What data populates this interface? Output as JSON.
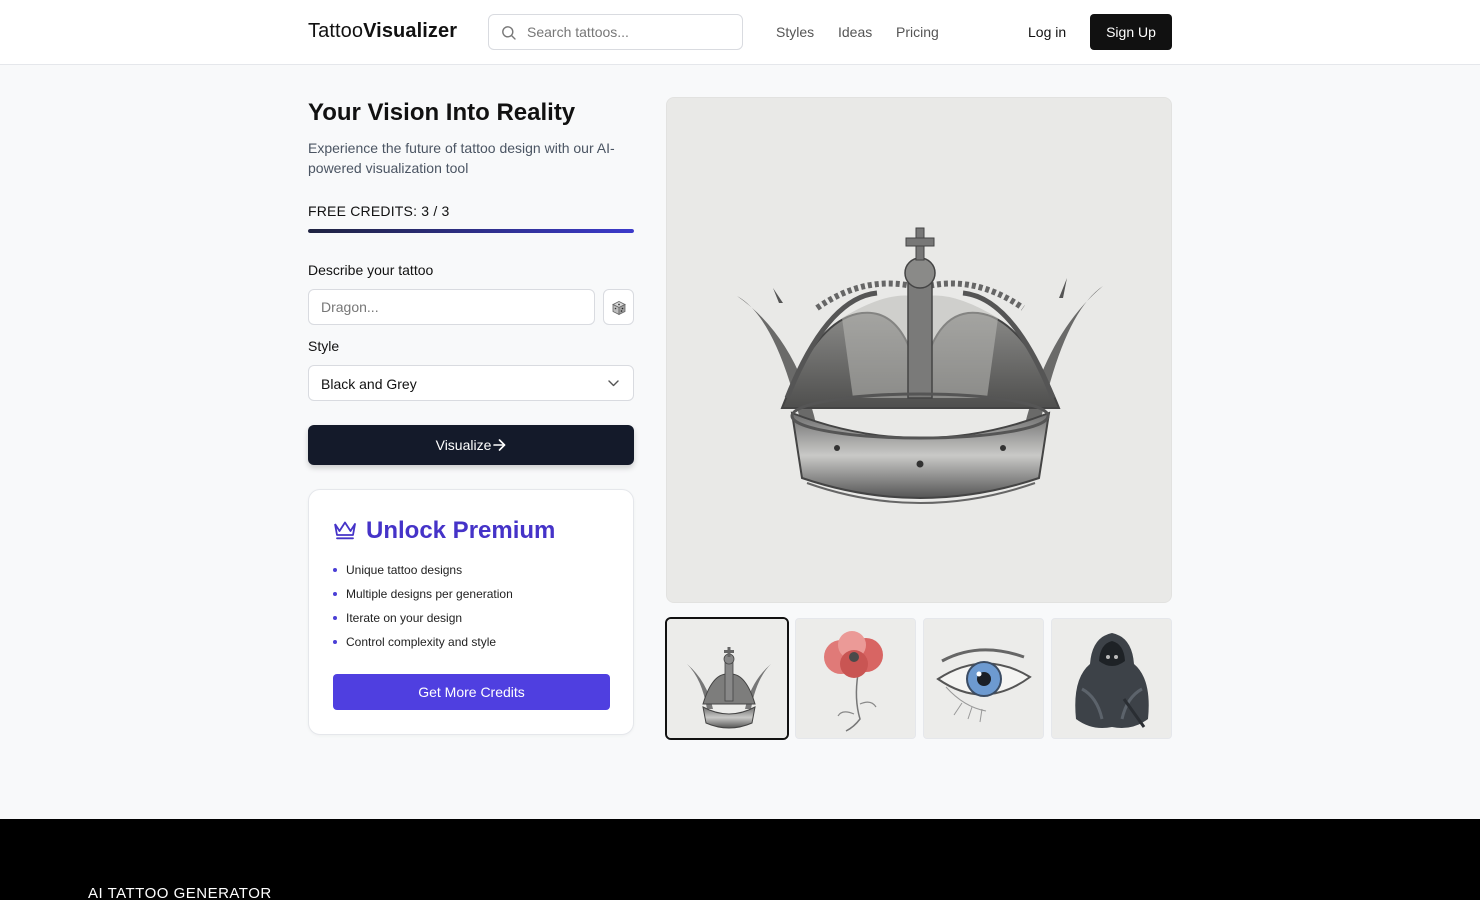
{
  "header": {
    "logo_regular": "Tattoo",
    "logo_bold": "Visualizer",
    "search_placeholder": "Search tattoos...",
    "nav": [
      "Styles",
      "Ideas",
      "Pricing"
    ],
    "login": "Log in",
    "signup": "Sign Up"
  },
  "hero": {
    "title": "Your Vision Into Reality",
    "subtitle": "Experience the future of tattoo design with our AI-powered visualization tool"
  },
  "credits": {
    "label": "FREE CREDITS: 3 / 3",
    "used": 3,
    "total": 3,
    "fill_fraction": 1.0
  },
  "form": {
    "prompt_label": "Describe your tattoo",
    "prompt_placeholder": "Dragon...",
    "prompt_value": "",
    "style_label": "Style",
    "style_value": "Black and Grey",
    "visualize_label": "Visualize"
  },
  "premium": {
    "title": "Unlock Premium",
    "features": [
      "Unique tattoo designs",
      "Multiple designs per generation",
      "Iterate on your design",
      "Control complexity and style"
    ],
    "button": "Get More Credits"
  },
  "gallery": {
    "main_image": "crown-tattoo",
    "thumbnails": [
      {
        "name": "crown-tattoo",
        "selected": true
      },
      {
        "name": "poppy-tattoo",
        "selected": false
      },
      {
        "name": "eye-tattoo",
        "selected": false
      },
      {
        "name": "reaper-tattoo",
        "selected": false
      }
    ]
  },
  "footer": {
    "title": "AI TATTOO GENERATOR"
  },
  "colors": {
    "accent": "#4f3fe0",
    "premium_title": "#4533c8",
    "dark_button": "#141a2a",
    "footer_bg": "#000000"
  },
  "icons": [
    "search-icon",
    "dice-icon",
    "chevron-down-icon",
    "arrow-right-icon",
    "crown-icon"
  ]
}
